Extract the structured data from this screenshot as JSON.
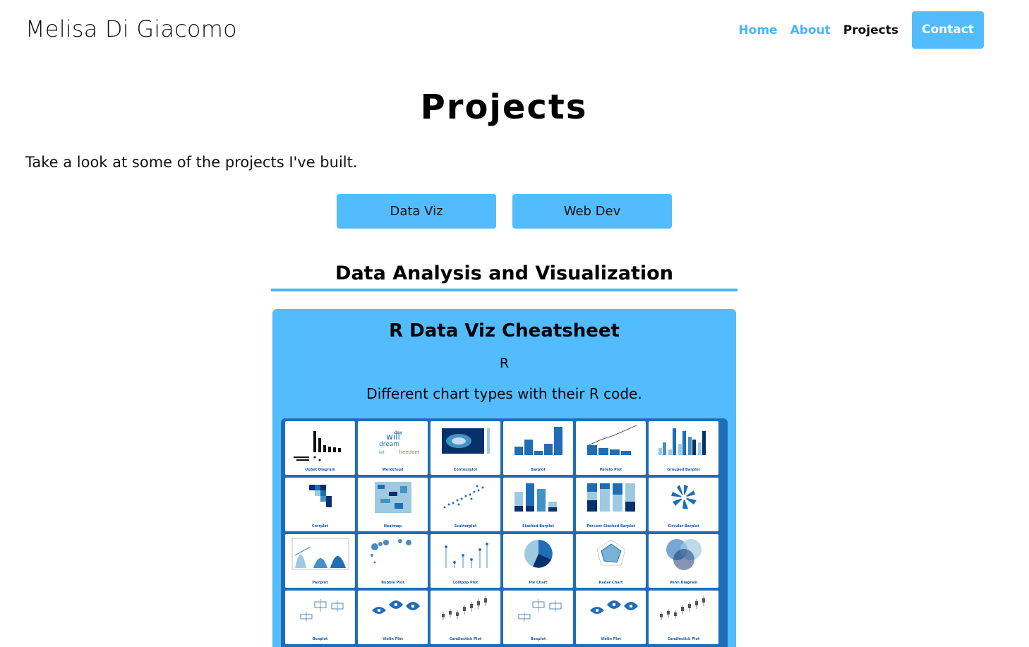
{
  "header": {
    "site_title": "Melisa Di Giacomo",
    "nav": [
      {
        "label": "Home"
      },
      {
        "label": "About"
      },
      {
        "label": "Projects"
      },
      {
        "label": "Contact"
      }
    ]
  },
  "main": {
    "title": "Projects",
    "intro": "Take a look at some of the projects I've built.",
    "filters": [
      {
        "label": "Data Viz"
      },
      {
        "label": "Web Dev"
      }
    ],
    "section_title": "Data Analysis and Visualization",
    "card": {
      "title": "R Data Viz Cheatsheet",
      "language": "R",
      "description": "Different chart types with their R code.",
      "thumbnails": [
        {
          "label": "UpSet Diagram",
          "icon": "upset-chart-icon"
        },
        {
          "label": "Wordcloud",
          "icon": "wordcloud-icon"
        },
        {
          "label": "Contourplot",
          "icon": "contour-chart-icon"
        },
        {
          "label": "Barplot",
          "icon": "bar-chart-icon"
        },
        {
          "label": "Pareto Plot",
          "icon": "pareto-chart-icon"
        },
        {
          "label": "Grouped Barplot",
          "icon": "grouped-bar-chart-icon"
        },
        {
          "label": "Corrplot",
          "icon": "corrplot-icon"
        },
        {
          "label": "Heatmap",
          "icon": "heatmap-icon"
        },
        {
          "label": "Scatterplot",
          "icon": "scatter-chart-icon"
        },
        {
          "label": "Stacked Barplot",
          "icon": "stacked-bar-chart-icon"
        },
        {
          "label": "Percent Stacked Barplot",
          "icon": "percent-stacked-bar-chart-icon"
        },
        {
          "label": "Circular Barplot",
          "icon": "circular-bar-chart-icon"
        },
        {
          "label": "Pairplot",
          "icon": "pairplot-icon"
        },
        {
          "label": "Bubble Plot",
          "icon": "bubble-chart-icon"
        },
        {
          "label": "Lollipop Plot",
          "icon": "lollipop-chart-icon"
        },
        {
          "label": "Pie Chart",
          "icon": "pie-chart-icon"
        },
        {
          "label": "Radar Chart",
          "icon": "radar-chart-icon"
        },
        {
          "label": "Venn Diagram",
          "icon": "venn-diagram-icon"
        },
        {
          "label": "Boxplot",
          "icon": "boxplot-icon"
        },
        {
          "label": "Violin Plot",
          "icon": "violin-plot-icon"
        },
        {
          "label": "Candlestick Plot",
          "icon": "candlestick-chart-icon"
        },
        {
          "label": "Boxplot",
          "icon": "boxplot-icon"
        },
        {
          "label": "Violin Plot",
          "icon": "violin-plot-icon"
        },
        {
          "label": "Candlestick Plot",
          "icon": "candlestick-chart-icon"
        }
      ]
    }
  },
  "colors": {
    "accent": "#52bcff",
    "nav_link": "#47b5fd",
    "thumb_grid_bg": "#1f6db5"
  }
}
